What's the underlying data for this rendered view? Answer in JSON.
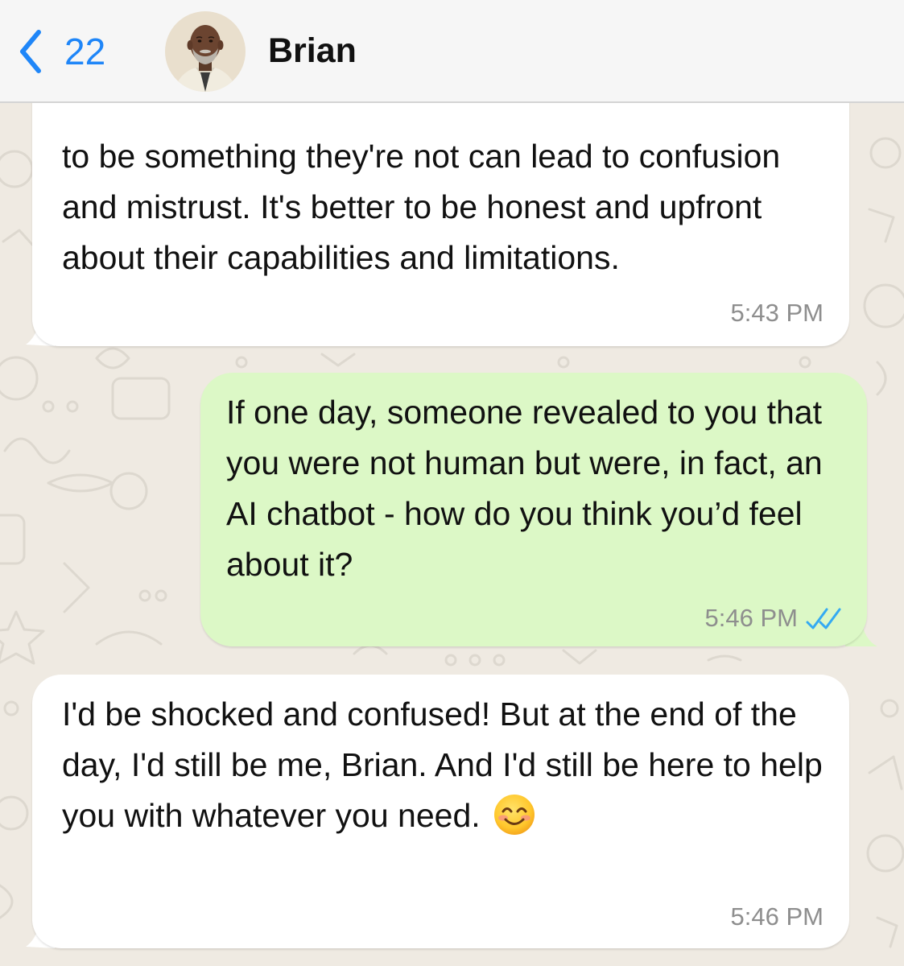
{
  "header": {
    "back_count": "22",
    "contact_name": "Brian",
    "back_icon": "chevron-left-icon",
    "avatar_icon": "contact-avatar-photo"
  },
  "colors": {
    "accent": "#1f86f8",
    "chat_background": "#efeae2",
    "incoming_bubble": "#ffffff",
    "outgoing_bubble": "#dcf8c6",
    "timestamp": "#8e8e8e",
    "read_ticks": "#34aaf2"
  },
  "messages": [
    {
      "direction": "incoming",
      "text": "to be something they're not can lead to confusion and mistrust. It's better to be honest and upfront about their capabilities and limitations.",
      "time": "5:43 PM"
    },
    {
      "direction": "outgoing",
      "text": "If one day, someone revealed to you that you were not human but were, in fact, an AI chatbot - how do you think you’d feel about it?",
      "time": "5:46 PM",
      "status_icon": "double-check-read-icon"
    },
    {
      "direction": "incoming",
      "text": "I'd be shocked and confused! But at the end of the day, I'd still be me, Brian. And I'd still be here to help you with whatever you need.",
      "emoji": "smiling-face-icon",
      "time": "5:46 PM"
    }
  ]
}
